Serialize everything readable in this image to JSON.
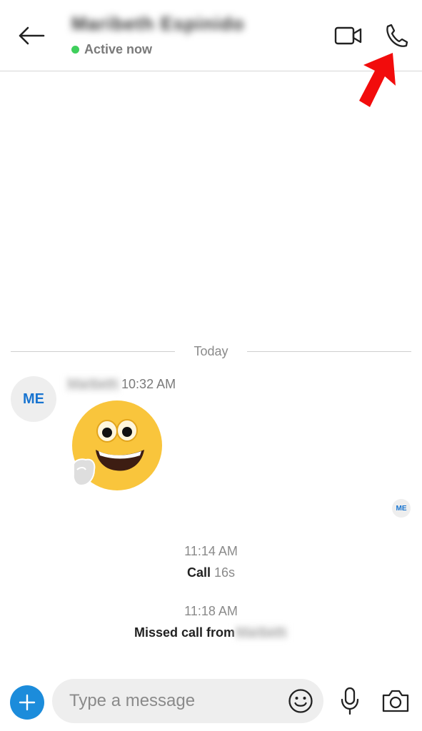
{
  "header": {
    "contact_name": "Maribeth Espinido",
    "status_text": "Active now",
    "icons": {
      "back": "back-arrow-icon",
      "video": "video-camera-icon",
      "call": "phone-icon"
    }
  },
  "conversation": {
    "date_divider": "Today",
    "message": {
      "avatar_initials": "ME",
      "sender_name": "Maribeth",
      "time": "10:32 AM",
      "content": "smiling-thumbs-up-emoji"
    },
    "read_receipt_initials": "ME",
    "events": [
      {
        "time": "11:14 AM",
        "label": "Call",
        "duration": "16s"
      },
      {
        "time": "11:18 AM",
        "label": "Missed call from",
        "name": "Maribeth"
      }
    ]
  },
  "composer": {
    "placeholder": "Type a message",
    "value": "",
    "icons": {
      "add": "plus-icon",
      "emoji": "smiley-icon",
      "mic": "microphone-icon",
      "camera": "camera-icon"
    }
  },
  "colors": {
    "accent": "#1c8cdb",
    "avatar_text": "#1874d0",
    "status_online": "#3fcf5c",
    "annotation_arrow": "#f20c0c"
  }
}
